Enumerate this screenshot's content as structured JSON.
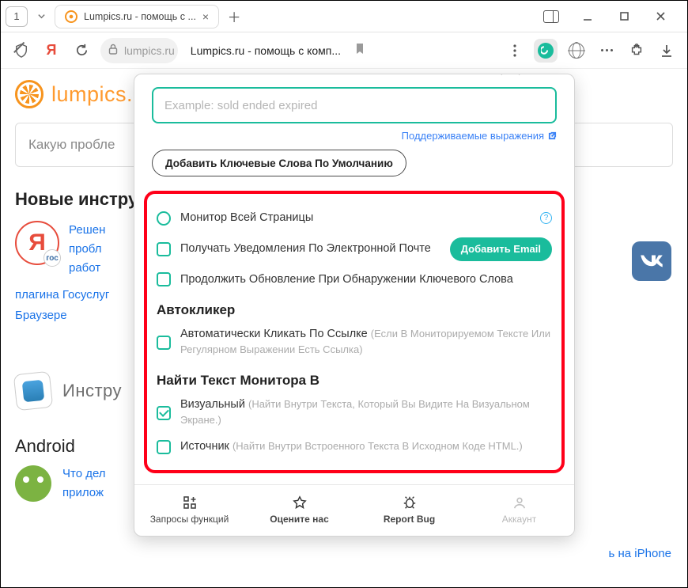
{
  "titlebar": {
    "tab_number": "1",
    "tab_title": "Lumpics.ru - помощь с ..."
  },
  "addressbar": {
    "domain": "lumpics.ru",
    "page_title": "Lumpics.ru - помощь с комп..."
  },
  "page": {
    "brand": "lumpics.r",
    "search_placeholder": "Какую пробле",
    "section_new": "Новые инстру",
    "yandex_lines": {
      "l1": "Решен",
      "l2": "пробл",
      "l3": "работ"
    },
    "followup1": "плагина Госуслуг",
    "followup2": "Браузере",
    "ios_label": "Инстру",
    "android_head": "Android",
    "android_l1": "Что дел",
    "android_l2": "прилож",
    "iphone_link": "ь на iPhone"
  },
  "popup": {
    "input_placeholder": "Example: sold ended expired",
    "supported_link": "Поддерживаемые выражения",
    "add_default_btn": "Добавить Ключевые Слова По Умолчанию",
    "opt_monitor_full": "Монитор Всей Страницы",
    "opt_email": "Получать Уведомления По Электронной Почте",
    "add_email_btn": "Добавить Email",
    "opt_continue": "Продолжить Обновление При Обнаружении Ключевого Слова",
    "section_autoclick": "Автокликер",
    "opt_autoclick": "Автоматически Кликать По Ссылке",
    "opt_autoclick_hint": "(Если В Мониторируемом Тексте Или Регулярном Выражении Есть Ссылка)",
    "section_find": "Найти Текст Монитора В",
    "opt_visual": "Визуальный",
    "opt_visual_hint": "(Найти Внутри Текста, Который Вы Видите На Визуальном Экране.)",
    "opt_source": "Источник",
    "opt_source_hint": "(Найти Внутри Встроенного Текста В Исходном Коде HTML.)",
    "footer": {
      "requests": "Запросы функций",
      "rate": "Оцените нас",
      "bug": "Report Bug",
      "account": "Аккаунт"
    }
  }
}
